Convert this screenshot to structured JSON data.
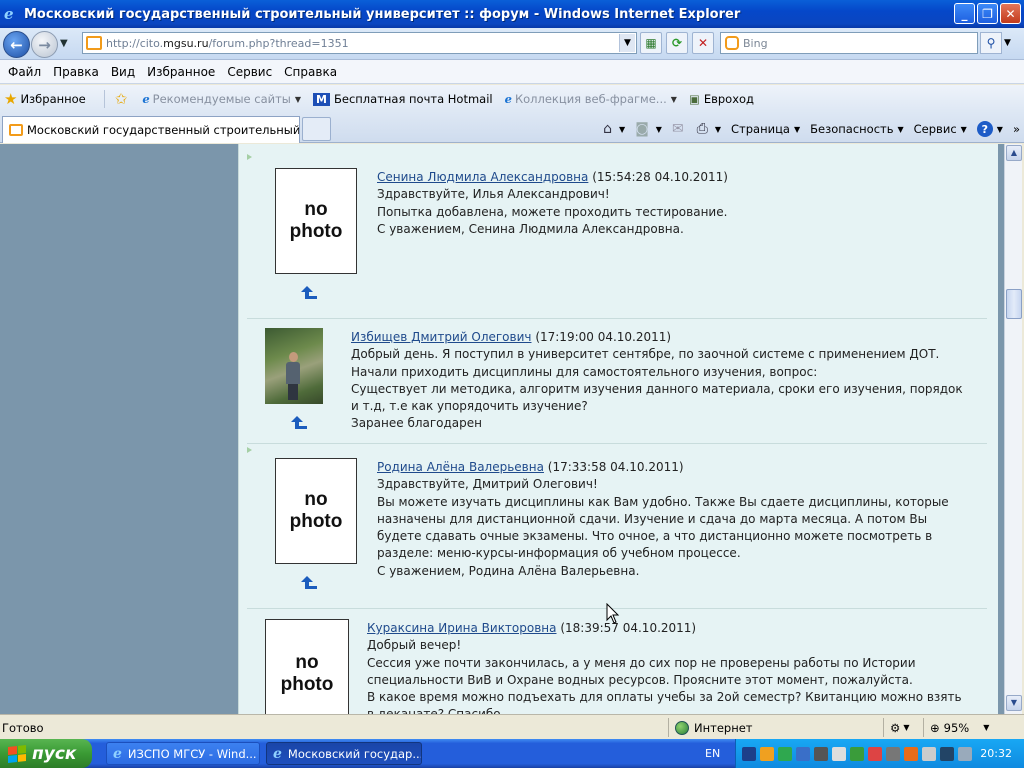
{
  "window": {
    "title": "Московский государственный строительный университет :: форум - Windows Internet Explorer",
    "minimize": "_",
    "maximize": "❐",
    "close": "✕"
  },
  "address": {
    "url_prefix": "http://cito.",
    "url_domain": "mgsu.ru",
    "url_suffix": "/forum.php?thread=1351",
    "search_placeholder": "Bing"
  },
  "menu": [
    "Файл",
    "Правка",
    "Вид",
    "Избранное",
    "Сервис",
    "Справка"
  ],
  "favorites": {
    "label": "Избранное",
    "items": [
      {
        "label": "Рекомендуемые сайты",
        "dim": true
      },
      {
        "label": "Бесплатная почта Hotmail",
        "dim": false
      },
      {
        "label": "Коллекция веб-фрагме...",
        "dim": true
      },
      {
        "label": "Евроход",
        "dim": false
      }
    ]
  },
  "tab": {
    "label": "Московский государственный строительный унив..."
  },
  "commands": {
    "page": "Страница",
    "safety": "Безопасность",
    "tools": "Сервис",
    "help": "?"
  },
  "posts": [
    {
      "author": "Сенина Людмила Александровна",
      "time": "(15:54:28 04.10.2011)",
      "photo": "no photo",
      "lines": [
        "Здравствуйте, Илья Александрович!",
        "Попытка добавлена, можете проходить тестирование.",
        "С уважением, Сенина Людмила Александровна."
      ]
    },
    {
      "author": "Избищев Дмитрий Олегович",
      "time": "(17:19:00 04.10.2011)",
      "photo": "",
      "lines": [
        "Добрый день. Я поступил в университет сентябре, по заочной системе с применением ДОТ. Начали приходить дисциплины для самостоятельного изучения, вопрос:",
        "Существует ли методика, алгоритм изучения данного материала, сроки его изучения, порядок и т.д, т.е как упорядочить изучение?",
        "Заранее благодарен"
      ]
    },
    {
      "author": "Родина Алёна Валерьевна",
      "time": "(17:33:58 04.10.2011)",
      "photo": "no photo",
      "lines": [
        "Здравствуйте, Дмитрий Олегович!",
        "Вы можете изучать дисциплины как Вам удобно. Также Вы сдаете дисциплины, которые назначены для дистанционной сдачи. Изучение и сдача до марта месяца. А потом Вы будете сдавать очные экзамены. Что очное, а что дистанционно можете посмотреть в разделе: меню-курсы-информация об учебном процессе.",
        "С уважением, Родина Алёна Валерьевна."
      ]
    },
    {
      "author": "Кураксина Ирина Викторовна",
      "time": "(18:39:57 04.10.2011)",
      "photo": "no photo",
      "lines": [
        "Добрый вечер!",
        "Сессия уже почти закончилась, а у меня до сих пор не проверены работы по Истории специальности ВиВ и Охране водных ресурсов. Проясните этот момент, пожалуйста.",
        "В какое время можно подъехать для оплаты учебы за 2ой семестр? Квитанцию можно взять в деканате? Спасибо."
      ]
    }
  ],
  "status": {
    "text": "Готово",
    "zone": "Интернет",
    "zoom": "95%"
  },
  "taskbar": {
    "start": "пуск",
    "tasks": [
      "ИЗСПО МГСУ - Wind...",
      "Московский государ..."
    ],
    "lang": "EN",
    "clock": "20:32"
  }
}
